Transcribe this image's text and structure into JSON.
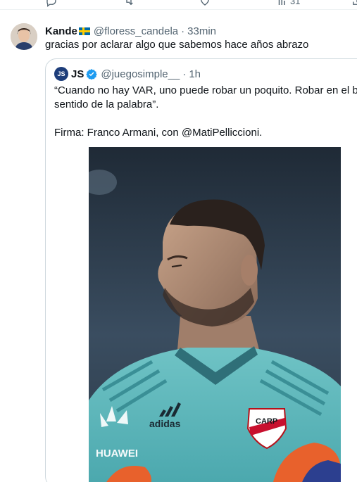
{
  "top_actions": {
    "views_count": "31"
  },
  "tweet": {
    "display_name": "Kande",
    "handle": "@floress_candela",
    "separator": "·",
    "time": "33min",
    "text": "gracias por aclarar algo que sabemos hace años abrazo"
  },
  "quote": {
    "avatar_text": "JS",
    "display_name": "JS",
    "handle": "@juegosimple__",
    "separator": "·",
    "time": "1h",
    "line1": "“Cuando no hay VAR, uno puede robar un poquito. Robar en el buen",
    "line2": "sentido de la palabra”.",
    "line3": "Firma: Franco Armani, con @MatiPelliccioni."
  },
  "media": {
    "brand_left": "HUAWEI",
    "brand_center": "adidas",
    "crest_text": "CARP"
  },
  "colors": {
    "text_primary": "#0f1419",
    "text_secondary": "#536471",
    "border": "#cfd9de",
    "verified_blue": "#1d9bf0"
  }
}
